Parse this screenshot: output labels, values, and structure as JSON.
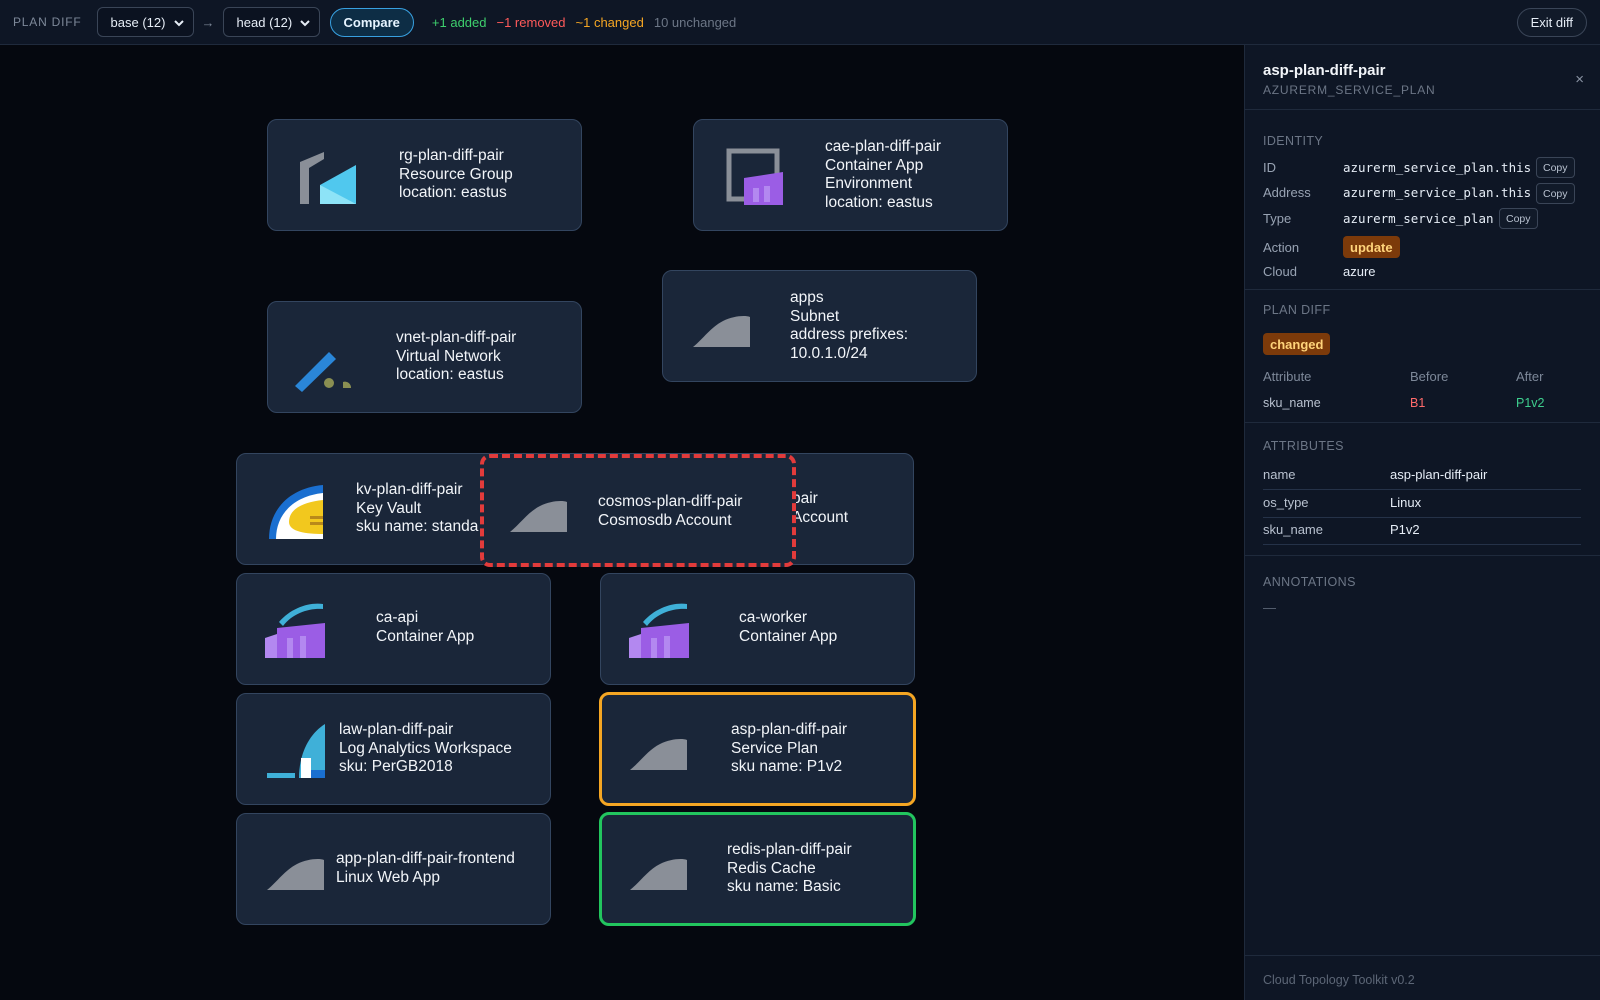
{
  "topbar": {
    "label": "PLAN DIFF",
    "base_select": "base (12)",
    "arrow": "→",
    "head_select": "head (12)",
    "compare_label": "Compare",
    "stats": {
      "added": "+1 added",
      "removed": "−1 removed",
      "changed": "~1 changed",
      "unchanged": "10 unchanged"
    },
    "exit_label": "Exit diff"
  },
  "nodes": {
    "rg": {
      "name": "rg-plan-diff-pair",
      "type": "Resource Group",
      "detail": "location: eastus",
      "icon": "resource-group-icon"
    },
    "cae": {
      "name": "cae-plan-diff-pair",
      "type1": "Container App",
      "type2": "Environment",
      "detail": "location: eastus",
      "icon": "container-app-environment-icon"
    },
    "apps": {
      "name": "apps",
      "type": "Subnet",
      "detail1": "address prefixes:",
      "detail2": "10.0.1.0/24",
      "icon": "generic-cloud-icon"
    },
    "vnet": {
      "name": "vnet-plan-diff-pair",
      "type": "Virtual Network",
      "detail": "location: eastus",
      "icon": "virtual-network-icon"
    },
    "kv": {
      "name": "kv-plan-diff-pair",
      "type": "Key Vault",
      "detail": "sku name: standa",
      "icon": "key-vault-icon"
    },
    "storage": {
      "name": "pair",
      "type": "Account"
    },
    "cosmos": {
      "name": "cosmos-plan-diff-pair",
      "type": "Cosmosdb Account",
      "status": "removed",
      "icon": "generic-cloud-icon"
    },
    "ca_api": {
      "name": "ca-api",
      "type": "Container App",
      "icon": "container-app-icon"
    },
    "ca_worker": {
      "name": "ca-worker",
      "type": "Container App",
      "icon": "container-app-icon"
    },
    "law": {
      "name": "law-plan-diff-pair",
      "type": "Log Analytics Workspace",
      "detail": "sku: PerGB2018",
      "icon": "log-analytics-icon"
    },
    "asp": {
      "name": "asp-plan-diff-pair",
      "type": "Service Plan",
      "detail": "sku name: P1v2",
      "status": "changed",
      "icon": "generic-cloud-icon"
    },
    "app": {
      "name": "app-plan-diff-pair-frontend",
      "type": "Linux Web App",
      "icon": "generic-cloud-icon"
    },
    "redis": {
      "name": "redis-plan-diff-pair",
      "type": "Redis Cache",
      "detail": "sku name: Basic",
      "status": "added",
      "icon": "generic-cloud-icon"
    }
  },
  "panel": {
    "title": "asp-plan-diff-pair",
    "subtitle": "AZURERM_SERVICE_PLAN",
    "close": "×",
    "identity_header": "IDENTITY",
    "identity": {
      "id_key": "ID",
      "id_val": "azurerm_service_plan.this",
      "address_key": "Address",
      "address_val": "azurerm_service_plan.this",
      "type_key": "Type",
      "type_val": "azurerm_service_plan",
      "action_key": "Action",
      "action_val": "update",
      "cloud_key": "Cloud",
      "cloud_val": "azure",
      "copy_label": "Copy"
    },
    "plan_diff_header": "PLAN DIFF",
    "plan_diff_badge": "changed",
    "diff_table": {
      "headers": [
        "Attribute",
        "Before",
        "After"
      ],
      "rows": [
        {
          "attribute": "sku_name",
          "before": "B1",
          "after": "P1v2"
        }
      ]
    },
    "attributes_header": "ATTRIBUTES",
    "attributes": [
      {
        "key": "name",
        "value": "asp-plan-diff-pair"
      },
      {
        "key": "os_type",
        "value": "Linux"
      },
      {
        "key": "sku_name",
        "value": "P1v2"
      }
    ],
    "annotations_header": "ANNOTATIONS",
    "annotations_value": "—",
    "footer": "Cloud Topology Toolkit v0.2"
  },
  "colors": {
    "added": "#3ecf6d",
    "removed": "#ff5a5a",
    "changed": "#f5a623",
    "accent": "#38a0e0"
  }
}
